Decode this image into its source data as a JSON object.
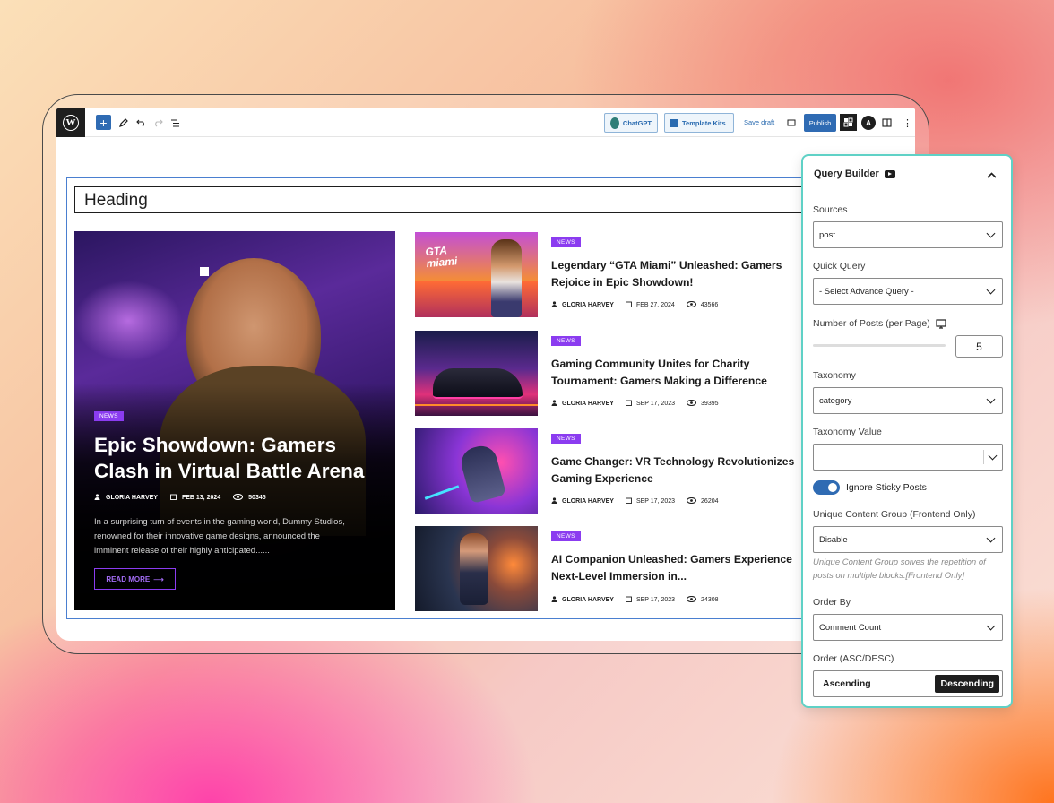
{
  "toolbar": {
    "chatgpt_label": "ChatGPT",
    "template_kits_label": "Template Kits",
    "save_draft_label": "Save draft",
    "publish_label": "Publish"
  },
  "content": {
    "heading": "Heading",
    "featured": {
      "badge": "NEWS",
      "title": "Epic Showdown: Gamers Clash in Virtual Battle Arena",
      "author": "GLORIA HARVEY",
      "date": "FEB 13, 2024",
      "views": "50345",
      "excerpt": "In a surprising turn of events in the gaming world, Dummy Studios, renowned for their innovative game designs, announced the imminent release of their highly anticipated......",
      "read_more": "READ MORE"
    },
    "posts": [
      {
        "badge": "NEWS",
        "title": "Legendary “GTA Miami” Unleashed: Gamers Rejoice in Epic Showdown!",
        "author": "GLORIA HARVEY",
        "date": "FEB 27, 2024",
        "views": "43566"
      },
      {
        "badge": "NEWS",
        "title": "Gaming Community Unites for Charity Tournament: Gamers Making a Difference",
        "author": "GLORIA HARVEY",
        "date": "SEP 17, 2023",
        "views": "39395"
      },
      {
        "badge": "NEWS",
        "title": "Game Changer: VR Technology Revolutionizes Gaming Experience",
        "author": "GLORIA HARVEY",
        "date": "SEP 17, 2023",
        "views": "26204"
      },
      {
        "badge": "NEWS",
        "title": "AI Companion Unleashed: Gamers Experience Next-Level Immersion in...",
        "author": "GLORIA HARVEY",
        "date": "SEP 17, 2023",
        "views": "24308"
      }
    ],
    "thumb1_text": "GTA miami"
  },
  "panel": {
    "title": "Query Builder",
    "sources_label": "Sources",
    "sources_value": "post",
    "quick_query_label": "Quick Query",
    "quick_query_value": "- Select Advance Query -",
    "num_posts_label": "Number of Posts (per Page)",
    "num_posts_value": "5",
    "taxonomy_label": "Taxonomy",
    "taxonomy_value": "category",
    "taxonomy_value_label": "Taxonomy Value",
    "taxonomy_value_value": "",
    "ignore_sticky_label": "Ignore Sticky Posts",
    "ignore_sticky_on": true,
    "unique_group_label": "Unique Content Group (Frontend Only)",
    "unique_group_value": "Disable",
    "unique_group_help": "Unique Content Group solves the repetition of posts on multiple blocks.[Frontend Only]",
    "order_by_label": "Order By",
    "order_by_value": "Comment Count",
    "order_label": "Order (ASC/DESC)",
    "order_asc": "Ascending",
    "order_desc": "Descending",
    "order_selected": "Descending"
  },
  "colors": {
    "accent": "#2f6bb3",
    "badge": "#8b3cf0",
    "panel_border": "#5fd1c6"
  }
}
